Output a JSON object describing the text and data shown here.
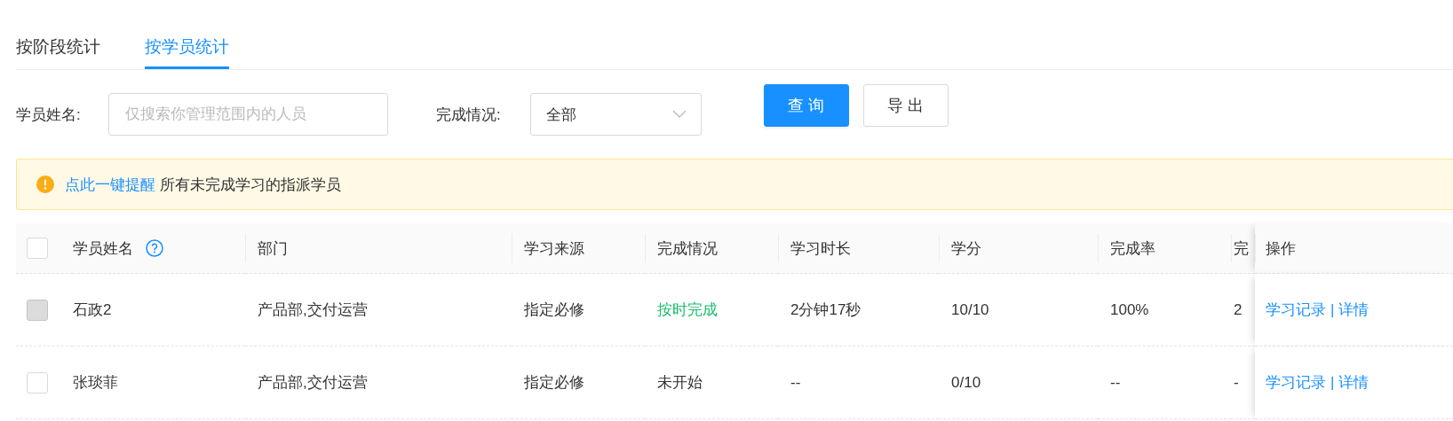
{
  "tabs": [
    {
      "label": "按阶段统计",
      "selected": false
    },
    {
      "label": "按学员统计",
      "selected": true
    }
  ],
  "filters": {
    "name_label": "学员姓名:",
    "name_placeholder": "仅搜索你管理范围内的人员",
    "status_label": "完成情况:",
    "status_value": "全部"
  },
  "buttons": [
    {
      "label": "查 询",
      "kind": "primary"
    },
    {
      "label": "导 出",
      "kind": "default"
    }
  ],
  "alert": {
    "link": "点此一键提醒",
    "text": "所有未完成学习的指派学员"
  },
  "table": {
    "select_all": {
      "checked": false
    },
    "columns": [
      "学员姓名",
      "部门",
      "学习来源",
      "完成情况",
      "学习时长",
      "学分",
      "完成率",
      "完",
      "操作"
    ],
    "rows": [
      {
        "checkbox": {
          "checked": false,
          "disabled": true
        },
        "name": "石政2",
        "department": "产品部,交付运营",
        "source": "指定必修",
        "status": {
          "text": "按时完成",
          "color": "#19be6b"
        },
        "duration": "2分钟17秒",
        "credit": "10/10",
        "rate": "100%",
        "column_8": "2",
        "actions": [
          "学习记录",
          "|",
          "详情"
        ]
      },
      {
        "checkbox": {
          "checked": false,
          "disabled": false
        },
        "name": "张琰菲",
        "department": "产品部,交付运营",
        "source": "指定必修",
        "status": {
          "text": "未开始",
          "color": "#333333"
        },
        "duration": "--",
        "credit": "0/10",
        "rate": "--",
        "column_8": "-",
        "actions": [
          "学习记录",
          "|",
          "详情"
        ]
      }
    ]
  }
}
